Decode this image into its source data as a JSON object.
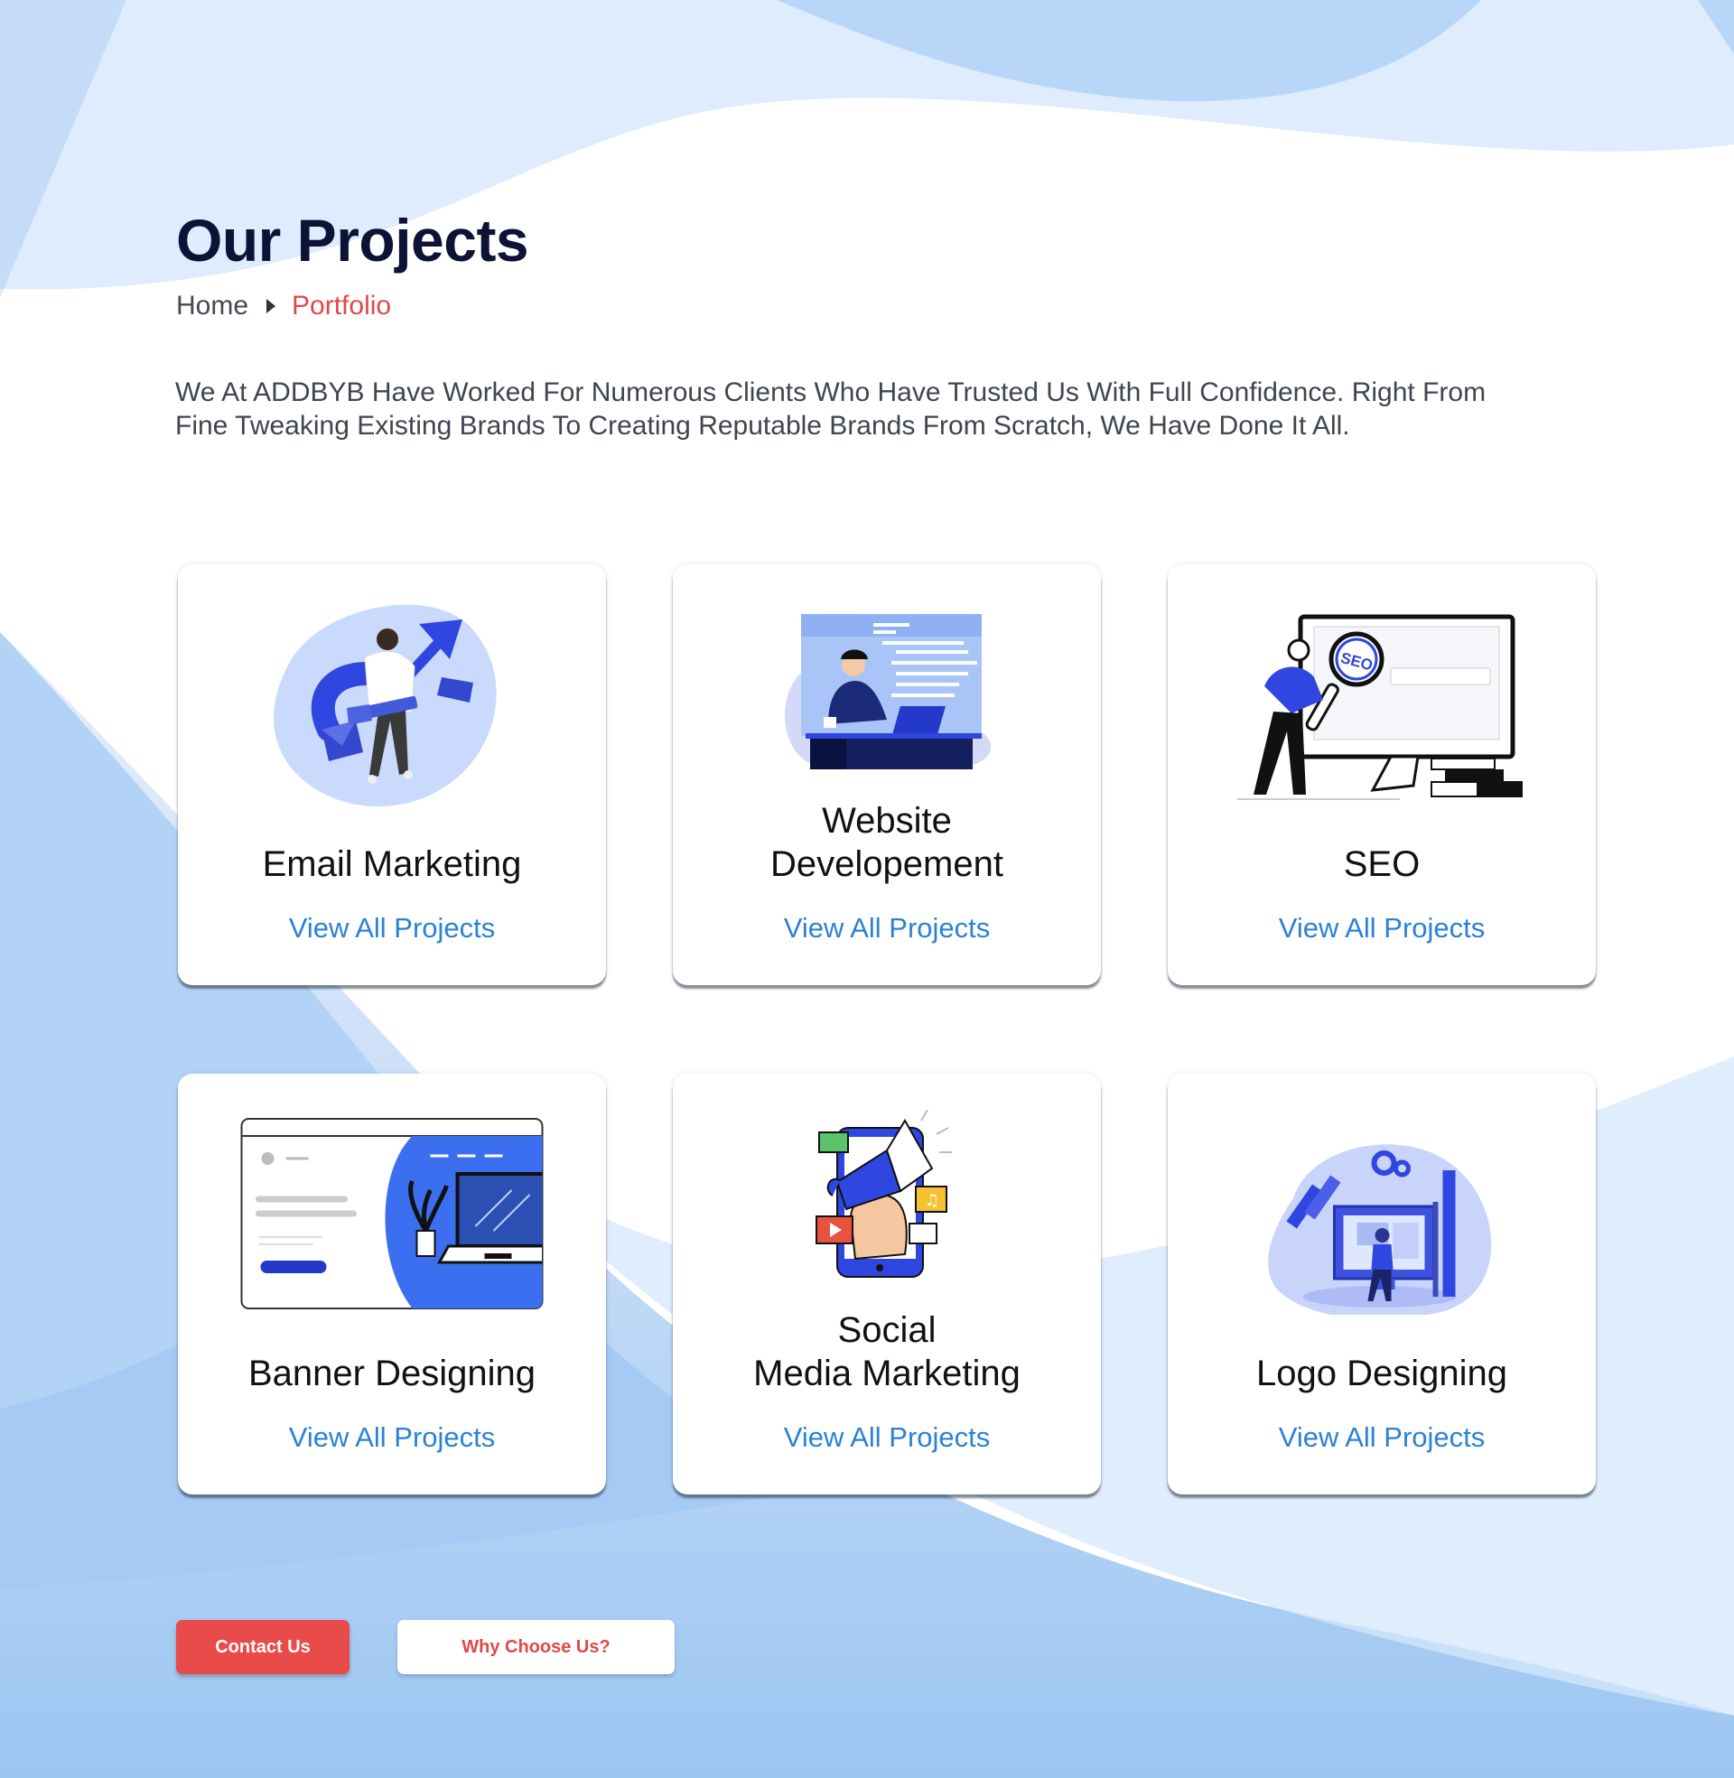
{
  "header": {
    "title": "Our Projects",
    "breadcrumb": {
      "home": "Home",
      "current": "Portfolio"
    },
    "intro_line1": "We At ADDBYB Have Worked For Numerous Clients Who Have Trusted Us With Full Confidence. Right From",
    "intro_line2": "Fine Tweaking Existing Brands To Creating Reputable Brands From Scratch, We Have Done It All."
  },
  "cards": [
    {
      "title_line1": "Email Marketing",
      "title_line2": "",
      "link": "View All Projects",
      "icon": "email-marketing-illustration"
    },
    {
      "title_line1": "Website",
      "title_line2": "Developement",
      "link": "View All Projects",
      "icon": "website-development-illustration"
    },
    {
      "title_line1": "SEO",
      "title_line2": "",
      "link": "View All Projects",
      "icon": "seo-magnifier-illustration"
    },
    {
      "title_line1": "Banner Designing",
      "title_line2": "",
      "link": "View All Projects",
      "icon": "banner-design-illustration"
    },
    {
      "title_line1": "Social",
      "title_line2": "Media Marketing",
      "link": "View All Projects",
      "icon": "social-media-illustration"
    },
    {
      "title_line1": "Logo Designing",
      "title_line2": "",
      "link": "View All Projects",
      "icon": "logo-design-illustration"
    }
  ],
  "actions": {
    "contact": "Contact Us",
    "why": "Why Choose Us?"
  },
  "colors": {
    "primary_red": "#e94a4a",
    "link_blue": "#2a82d6",
    "title_navy": "#0c1334",
    "accent_blue": "#2f46e0"
  }
}
